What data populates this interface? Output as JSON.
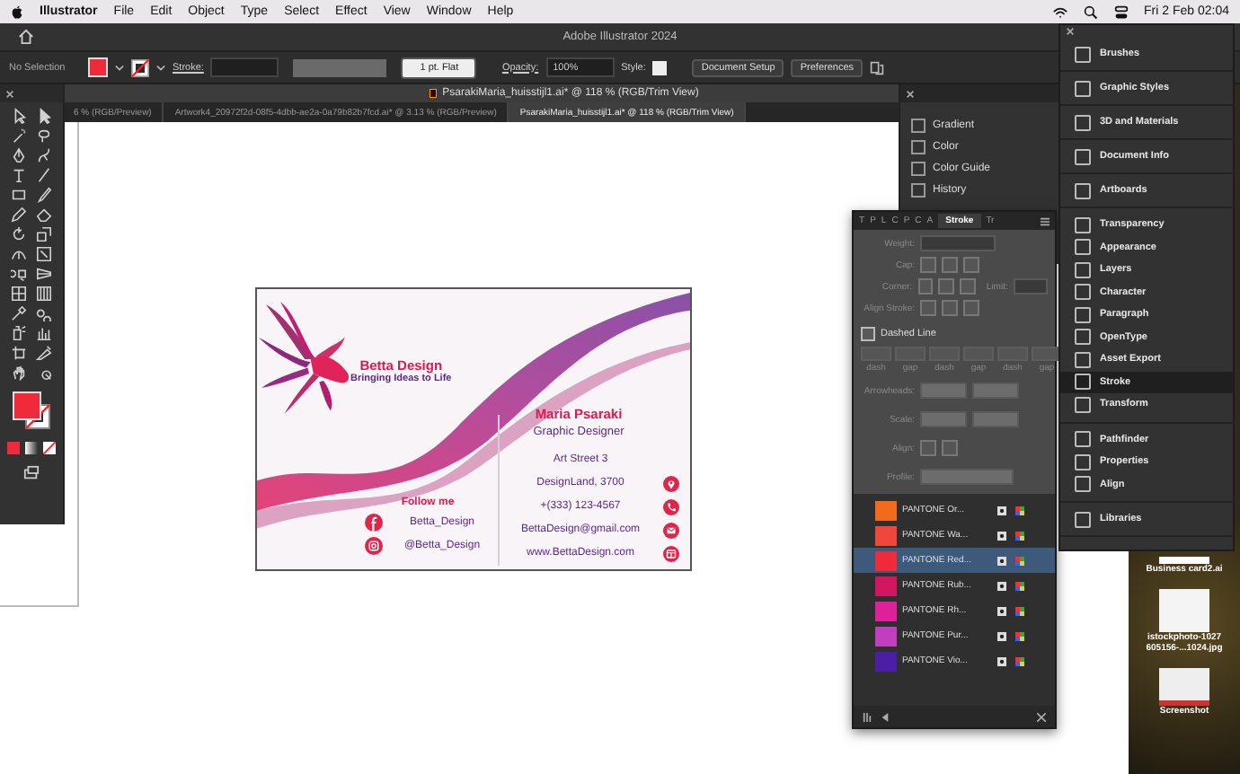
{
  "menu_bar": {
    "app": "Illustrator",
    "items": [
      "File",
      "Edit",
      "Object",
      "Type",
      "Select",
      "Effect",
      "View",
      "Window",
      "Help"
    ],
    "clock": "Fri 2 Feb  02:04"
  },
  "app_title": "Adobe Illustrator 2024",
  "control_bar": {
    "selection": "No Selection",
    "stroke_label": "Stroke:",
    "brush": "1 pt. Flat",
    "opacity_label": "Opacity:",
    "opacity": "100%",
    "style_label": "Style:",
    "buttons": [
      "Document Setup",
      "Preferences"
    ]
  },
  "document": {
    "title": "PsarakiMaria_huisstijl1.ai* @ 118 % (RGB/Trim View)",
    "tabs": [
      {
        "label": "6 % (RGB/Preview)",
        "selected": false
      },
      {
        "label": "Artwork4_20972f2d-08f5-4dbb-ae2a-0a79b82b7fcd.ai* @ 3.13 % (RGB/Preview)",
        "selected": false
      },
      {
        "label": "PsarakiMaria_huisstijl1.ai* @ 118 % (RGB/Trim View)",
        "selected": true
      }
    ]
  },
  "card": {
    "brand": "Betta Design",
    "tagline": "Bringing Ideas to Life",
    "name": "Maria Psaraki",
    "role": "Graphic Designer",
    "follow": "Follow me",
    "contacts": [
      {
        "text": "Art Street 3",
        "kind": "none"
      },
      {
        "text": "DesignLand, 3700",
        "kind": "location"
      },
      {
        "text": "+(333) 123-4567",
        "kind": "phone"
      },
      {
        "text": "BettaDesign@gmail.com",
        "kind": "mail"
      },
      {
        "text": "www.BettaDesign.com",
        "kind": "web"
      }
    ],
    "socials": [
      {
        "text": "Betta_Design",
        "kind": "facebook"
      },
      {
        "text": "@Betta_Design",
        "kind": "instagram"
      }
    ]
  },
  "dock_panels": [
    "Gradient",
    "Color",
    "Color Guide",
    "History"
  ],
  "stroke_panel": {
    "tabs": [
      {
        "label": "T",
        "selected": false
      },
      {
        "label": "P",
        "selected": false
      },
      {
        "label": "L",
        "selected": false
      },
      {
        "label": "C",
        "selected": false
      },
      {
        "label": "P",
        "selected": false
      },
      {
        "label": "C",
        "selected": false
      },
      {
        "label": "A",
        "selected": false
      },
      {
        "label": "Stroke",
        "selected": true
      },
      {
        "label": "Tr",
        "selected": false
      }
    ],
    "rows": [
      {
        "label": "Weight:",
        "kind": "spinner"
      },
      {
        "label": "Cap:",
        "kind": "buttons"
      },
      {
        "label": "Corner:",
        "kind": "corner",
        "extra": "Limit:"
      },
      {
        "label": "Align Stroke:",
        "kind": "buttons"
      }
    ],
    "dashed": {
      "label": "Dashed Line",
      "checked": false
    },
    "dash_labels": [
      "dash",
      "gap",
      "dash",
      "gap",
      "dash",
      "gap"
    ],
    "rows2": [
      {
        "label": "Arrowheads:",
        "kind": "dropdowns"
      },
      {
        "label": "Scale:",
        "kind": "spinners"
      },
      {
        "label": "Align:",
        "kind": "pair"
      },
      {
        "label": "Profile:",
        "kind": "profile"
      }
    ]
  },
  "swatches": [
    {
      "name": "PANTONE Or...",
      "color": "#f26a1b",
      "selected": false
    },
    {
      "name": "PANTONE Wa...",
      "color": "#f0463c",
      "selected": false
    },
    {
      "name": "PANTONE Red...",
      "color": "#ee2a3b",
      "selected": true
    },
    {
      "name": "PANTONE Rub...",
      "color": "#d0175f",
      "selected": false
    },
    {
      "name": "PANTONE Rh...",
      "color": "#e0209a",
      "selected": false
    },
    {
      "name": "PANTONE Pur...",
      "color": "#c13fbf",
      "selected": false
    },
    {
      "name": "PANTONE Vio...",
      "color": "#4a1fa6",
      "selected": false
    }
  ],
  "panel_list": [
    {
      "items": [
        {
          "label": "Brushes",
          "selected": false
        }
      ]
    },
    {
      "items": [
        {
          "label": "Graphic Styles",
          "selected": false
        }
      ]
    },
    {
      "items": [
        {
          "label": "3D and Materials",
          "selected": false
        }
      ]
    },
    {
      "items": [
        {
          "label": "Document Info",
          "selected": false
        }
      ]
    },
    {
      "items": [
        {
          "label": "Artboards",
          "selected": false
        }
      ]
    },
    {
      "items": [
        {
          "label": "Transparency",
          "selected": false
        },
        {
          "label": "Appearance",
          "selected": false
        },
        {
          "label": "Layers",
          "selected": false
        },
        {
          "label": "Character",
          "selected": false
        },
        {
          "label": "Paragraph",
          "selected": false
        },
        {
          "label": "OpenType",
          "selected": false
        },
        {
          "label": "Asset Export",
          "selected": false
        },
        {
          "label": "Stroke",
          "selected": true
        },
        {
          "label": "Transform",
          "selected": false
        }
      ]
    },
    {
      "items": [
        {
          "label": "Pathfinder",
          "selected": false
        },
        {
          "label": "Properties",
          "selected": false
        },
        {
          "label": "Align",
          "selected": false
        }
      ]
    },
    {
      "items": [
        {
          "label": "Libraries",
          "selected": false
        }
      ]
    }
  ],
  "desktop_files": [
    {
      "lines": [
        "Business card2.ai"
      ],
      "kind": "document"
    },
    {
      "lines": [
        "istockphoto-1027",
        "605156-...1024.jpg"
      ],
      "kind": "photo"
    },
    {
      "lines": [
        "Screenshot"
      ],
      "kind": "screenshot"
    }
  ]
}
